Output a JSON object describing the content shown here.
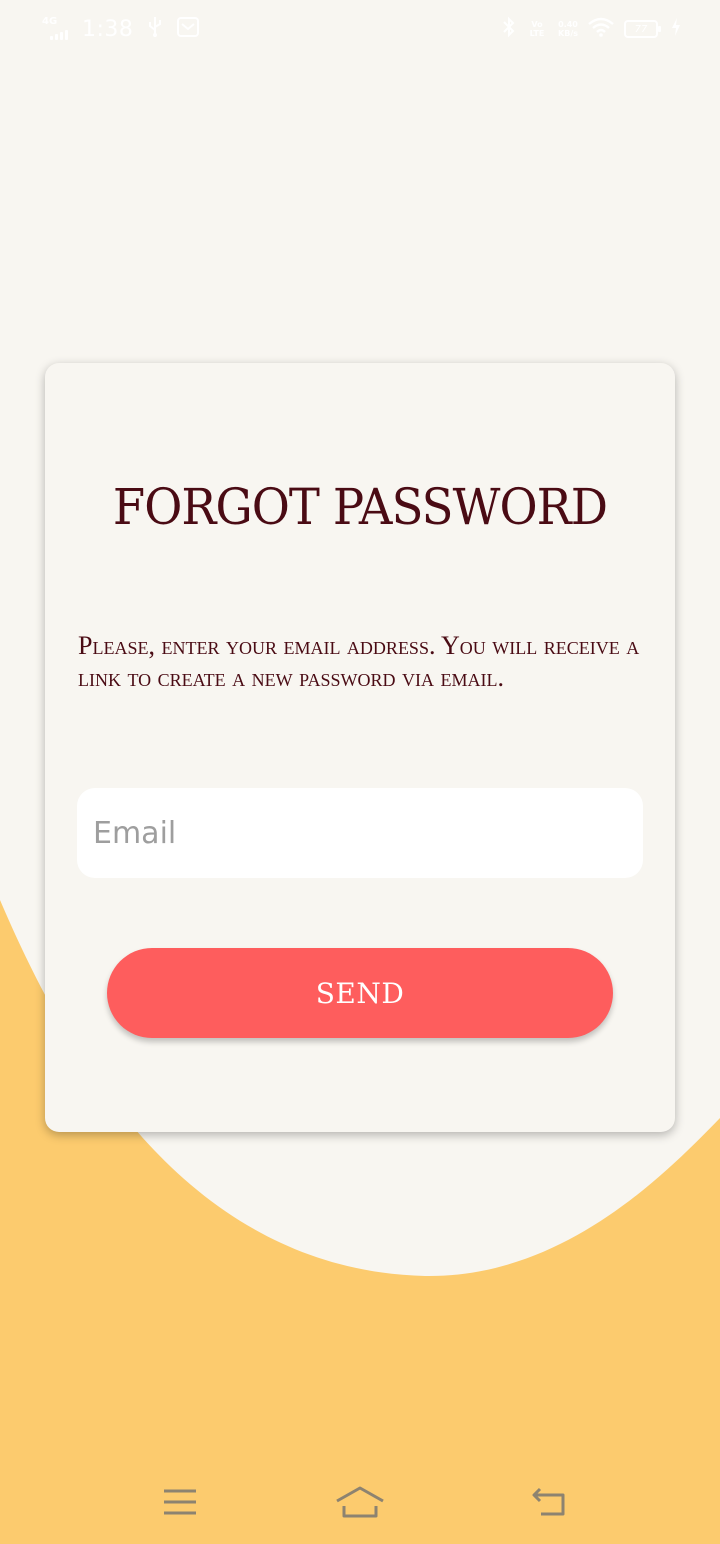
{
  "status_bar": {
    "network": "4G",
    "time": "1:38",
    "volte_label": "Vo LTE",
    "speed_value": "0.40",
    "speed_unit": "KB/s",
    "battery_level": "77"
  },
  "card": {
    "title": "FORGOT PASSWORD",
    "description": "Please, enter your email address. You will receive a link to create a new password via email.",
    "email_placeholder": "Email",
    "email_value": "",
    "send_label": "SEND"
  },
  "colors": {
    "background": "#f8f6f1",
    "accent_orange": "#fccb6e",
    "title_text": "#4a0b14",
    "button": "#fe5d5d"
  },
  "nav_bar": {
    "icons": [
      "menu-icon",
      "home-icon",
      "back-icon"
    ]
  }
}
